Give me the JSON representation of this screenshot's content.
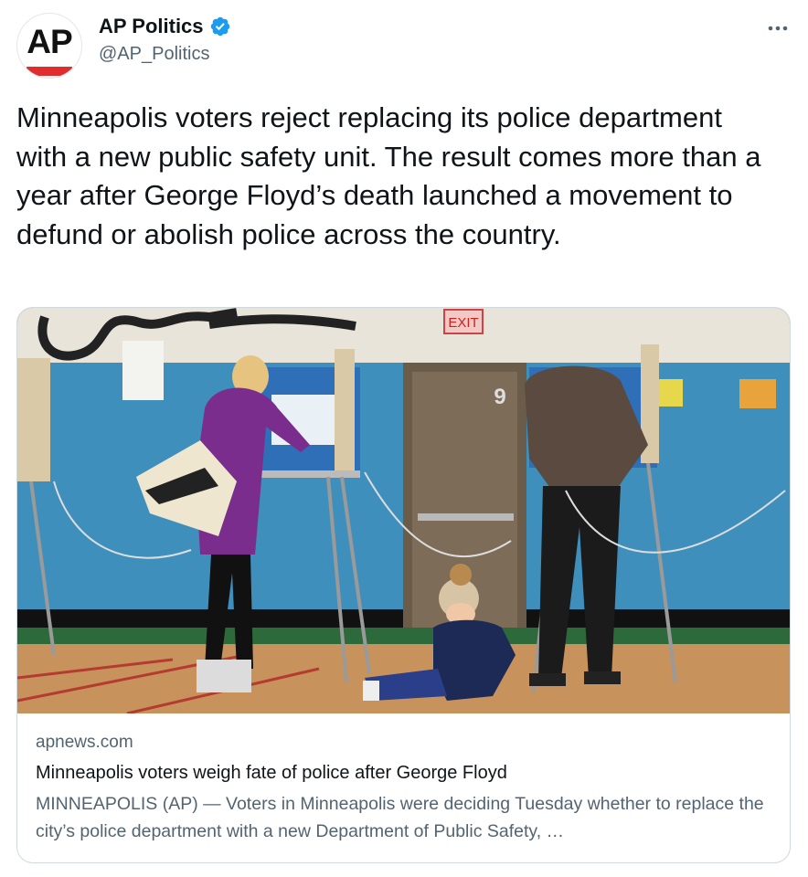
{
  "account": {
    "display_name": "AP Politics",
    "handle": "@AP_Politics",
    "avatar_text": "AP",
    "verified": true
  },
  "tweet": {
    "text": "Minneapolis voters reject replacing its police department with a new public safety unit. The result comes more than a year after George Floyd’s death launched a movement to defund or abolish police across the country."
  },
  "link_card": {
    "domain": "apnews.com",
    "title": "Minneapolis voters weigh fate of police after George Floyd",
    "description": "MINNEAPOLIS (AP) — Voters in Minneapolis were deciding Tuesday whether to replace the city’s police department with a new Department of Public Safety, …",
    "image_signs": {
      "exit": "EXIT",
      "door_number": "9"
    }
  },
  "icons": {
    "verified": "verified-badge-icon",
    "more": "more-options-icon"
  },
  "colors": {
    "verified_blue": "#1d9bf0",
    "ap_red": "#e22d2f",
    "secondary_text": "#536471"
  }
}
